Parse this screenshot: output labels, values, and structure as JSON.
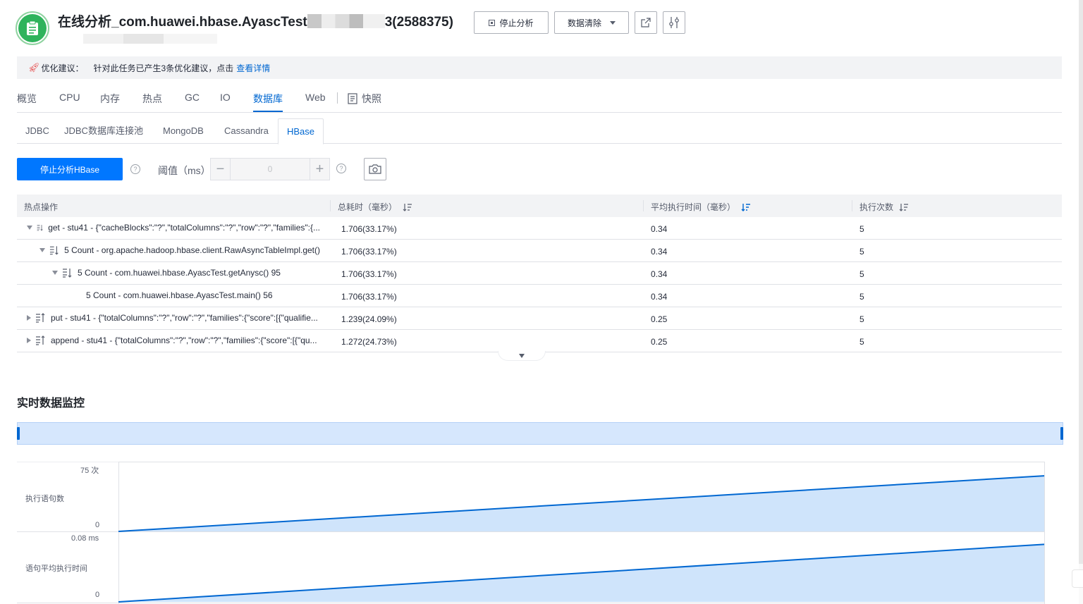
{
  "header": {
    "title_prefix": "在线分析_com.huawei.hbase.AyascTest",
    "title_suffix": "3(2588375)",
    "stop_label": "停止分析",
    "clear_label": "数据清除"
  },
  "suggestion": {
    "label": "优化建议：",
    "text": "针对此任务已产生3条优化建议，点击",
    "link": "查看详情"
  },
  "tabs": [
    "概览",
    "CPU",
    "内存",
    "热点",
    "GC",
    "IO",
    "数据库",
    "Web",
    "快照"
  ],
  "active_tab": "数据库",
  "subtabs": [
    "JDBC",
    "JDBC数据库连接池",
    "MongoDB",
    "Cassandra",
    "HBase"
  ],
  "active_subtab": "HBase",
  "toolbar": {
    "primary_label": "停止分析HBase",
    "threshold_label": "阈值（ms）",
    "threshold_value": "0",
    "help": "?"
  },
  "table": {
    "columns": [
      "热点操作",
      "总耗时（毫秒）",
      "平均执行时间（毫秒）",
      "执行次数"
    ],
    "rows": [
      {
        "level": 0,
        "toggle": "expanded",
        "icon": "sort-desc-icon",
        "op": "get - stu41 - {\"cacheBlocks\":\"?\",\"totalColumns\":\"?\",\"row\":\"?\",\"families\":{...",
        "total": "1.706(33.17%)",
        "avg": "0.34",
        "count": "5"
      },
      {
        "level": 1,
        "toggle": "expanded",
        "icon": "sort-desc-icon",
        "op": "5 Count - org.apache.hadoop.hbase.client.RawAsyncTableImpl.get()",
        "total": "1.706(33.17%)",
        "avg": "0.34",
        "count": "5"
      },
      {
        "level": 2,
        "toggle": "expanded",
        "icon": "sort-desc-icon",
        "op": "5 Count - com.huawei.hbase.AyascTest.getAnysc() 95",
        "total": "1.706(33.17%)",
        "avg": "0.34",
        "count": "5"
      },
      {
        "level": 3,
        "toggle": "none",
        "icon": "",
        "op": "5 Count - com.huawei.hbase.AyascTest.main() 56",
        "total": "1.706(33.17%)",
        "avg": "0.34",
        "count": "5"
      },
      {
        "level": 0,
        "toggle": "collapsed",
        "icon": "sort-asc-icon",
        "op": "put - stu41 - {\"totalColumns\":\"?\",\"row\":\"?\",\"families\":{\"score\":[{\"qualifie...",
        "total": "1.239(24.09%)",
        "avg": "0.25",
        "count": "5"
      },
      {
        "level": 0,
        "toggle": "collapsed",
        "icon": "sort-asc-icon",
        "op": "append - stu41 - {\"totalColumns\":\"?\",\"row\":\"?\",\"families\":{\"score\":[{\"qu...",
        "total": "1.272(24.73%)",
        "avg": "0.25",
        "count": "5"
      }
    ]
  },
  "monitor": {
    "title": "实时数据监控"
  },
  "chart_data": [
    {
      "type": "area",
      "ylabel": "执行语句数",
      "y_max_label": "75 次",
      "y_min_label": "0",
      "ylim": [
        0,
        75
      ],
      "x": [
        0,
        1
      ],
      "values": [
        0,
        61
      ],
      "color": "#0067d1",
      "fill": "#cfe4fb"
    },
    {
      "type": "area",
      "ylabel": "语句平均执行时间",
      "y_max_label": "0.08 ms",
      "y_min_label": "0",
      "ylim": [
        0,
        0.08
      ],
      "x": [
        0,
        1
      ],
      "values": [
        0,
        0.066
      ],
      "color": "#0067d1",
      "fill": "#cfe4fb"
    }
  ],
  "colors": {
    "accent": "#0067d1",
    "primary_button": "#0077ff",
    "success": "#2fb35c"
  }
}
